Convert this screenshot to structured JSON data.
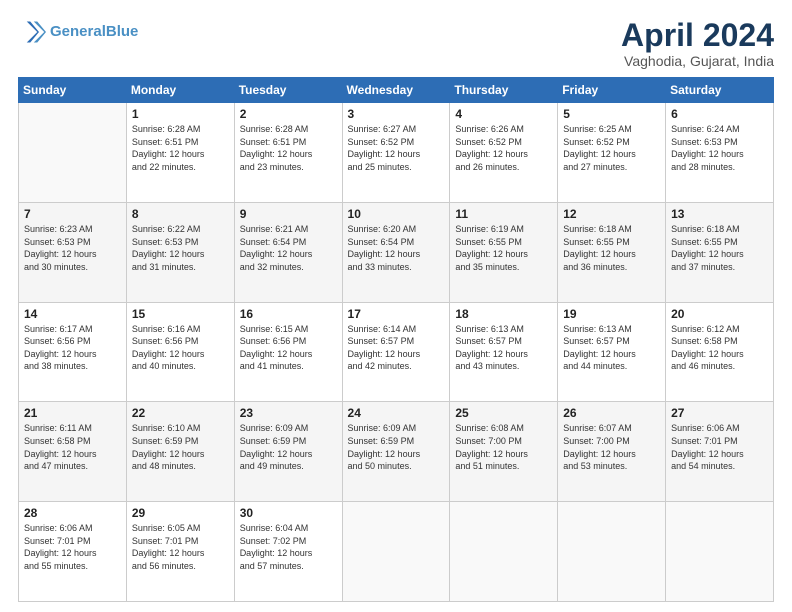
{
  "logo": {
    "line1": "General",
    "line2": "Blue"
  },
  "title": "April 2024",
  "location": "Vaghodia, Gujarat, India",
  "weekdays": [
    "Sunday",
    "Monday",
    "Tuesday",
    "Wednesday",
    "Thursday",
    "Friday",
    "Saturday"
  ],
  "weeks": [
    [
      {
        "day": "",
        "info": ""
      },
      {
        "day": "1",
        "info": "Sunrise: 6:28 AM\nSunset: 6:51 PM\nDaylight: 12 hours\nand 22 minutes."
      },
      {
        "day": "2",
        "info": "Sunrise: 6:28 AM\nSunset: 6:51 PM\nDaylight: 12 hours\nand 23 minutes."
      },
      {
        "day": "3",
        "info": "Sunrise: 6:27 AM\nSunset: 6:52 PM\nDaylight: 12 hours\nand 25 minutes."
      },
      {
        "day": "4",
        "info": "Sunrise: 6:26 AM\nSunset: 6:52 PM\nDaylight: 12 hours\nand 26 minutes."
      },
      {
        "day": "5",
        "info": "Sunrise: 6:25 AM\nSunset: 6:52 PM\nDaylight: 12 hours\nand 27 minutes."
      },
      {
        "day": "6",
        "info": "Sunrise: 6:24 AM\nSunset: 6:53 PM\nDaylight: 12 hours\nand 28 minutes."
      }
    ],
    [
      {
        "day": "7",
        "info": "Sunrise: 6:23 AM\nSunset: 6:53 PM\nDaylight: 12 hours\nand 30 minutes."
      },
      {
        "day": "8",
        "info": "Sunrise: 6:22 AM\nSunset: 6:53 PM\nDaylight: 12 hours\nand 31 minutes."
      },
      {
        "day": "9",
        "info": "Sunrise: 6:21 AM\nSunset: 6:54 PM\nDaylight: 12 hours\nand 32 minutes."
      },
      {
        "day": "10",
        "info": "Sunrise: 6:20 AM\nSunset: 6:54 PM\nDaylight: 12 hours\nand 33 minutes."
      },
      {
        "day": "11",
        "info": "Sunrise: 6:19 AM\nSunset: 6:55 PM\nDaylight: 12 hours\nand 35 minutes."
      },
      {
        "day": "12",
        "info": "Sunrise: 6:18 AM\nSunset: 6:55 PM\nDaylight: 12 hours\nand 36 minutes."
      },
      {
        "day": "13",
        "info": "Sunrise: 6:18 AM\nSunset: 6:55 PM\nDaylight: 12 hours\nand 37 minutes."
      }
    ],
    [
      {
        "day": "14",
        "info": "Sunrise: 6:17 AM\nSunset: 6:56 PM\nDaylight: 12 hours\nand 38 minutes."
      },
      {
        "day": "15",
        "info": "Sunrise: 6:16 AM\nSunset: 6:56 PM\nDaylight: 12 hours\nand 40 minutes."
      },
      {
        "day": "16",
        "info": "Sunrise: 6:15 AM\nSunset: 6:56 PM\nDaylight: 12 hours\nand 41 minutes."
      },
      {
        "day": "17",
        "info": "Sunrise: 6:14 AM\nSunset: 6:57 PM\nDaylight: 12 hours\nand 42 minutes."
      },
      {
        "day": "18",
        "info": "Sunrise: 6:13 AM\nSunset: 6:57 PM\nDaylight: 12 hours\nand 43 minutes."
      },
      {
        "day": "19",
        "info": "Sunrise: 6:13 AM\nSunset: 6:57 PM\nDaylight: 12 hours\nand 44 minutes."
      },
      {
        "day": "20",
        "info": "Sunrise: 6:12 AM\nSunset: 6:58 PM\nDaylight: 12 hours\nand 46 minutes."
      }
    ],
    [
      {
        "day": "21",
        "info": "Sunrise: 6:11 AM\nSunset: 6:58 PM\nDaylight: 12 hours\nand 47 minutes."
      },
      {
        "day": "22",
        "info": "Sunrise: 6:10 AM\nSunset: 6:59 PM\nDaylight: 12 hours\nand 48 minutes."
      },
      {
        "day": "23",
        "info": "Sunrise: 6:09 AM\nSunset: 6:59 PM\nDaylight: 12 hours\nand 49 minutes."
      },
      {
        "day": "24",
        "info": "Sunrise: 6:09 AM\nSunset: 6:59 PM\nDaylight: 12 hours\nand 50 minutes."
      },
      {
        "day": "25",
        "info": "Sunrise: 6:08 AM\nSunset: 7:00 PM\nDaylight: 12 hours\nand 51 minutes."
      },
      {
        "day": "26",
        "info": "Sunrise: 6:07 AM\nSunset: 7:00 PM\nDaylight: 12 hours\nand 53 minutes."
      },
      {
        "day": "27",
        "info": "Sunrise: 6:06 AM\nSunset: 7:01 PM\nDaylight: 12 hours\nand 54 minutes."
      }
    ],
    [
      {
        "day": "28",
        "info": "Sunrise: 6:06 AM\nSunset: 7:01 PM\nDaylight: 12 hours\nand 55 minutes."
      },
      {
        "day": "29",
        "info": "Sunrise: 6:05 AM\nSunset: 7:01 PM\nDaylight: 12 hours\nand 56 minutes."
      },
      {
        "day": "30",
        "info": "Sunrise: 6:04 AM\nSunset: 7:02 PM\nDaylight: 12 hours\nand 57 minutes."
      },
      {
        "day": "",
        "info": ""
      },
      {
        "day": "",
        "info": ""
      },
      {
        "day": "",
        "info": ""
      },
      {
        "day": "",
        "info": ""
      }
    ]
  ]
}
